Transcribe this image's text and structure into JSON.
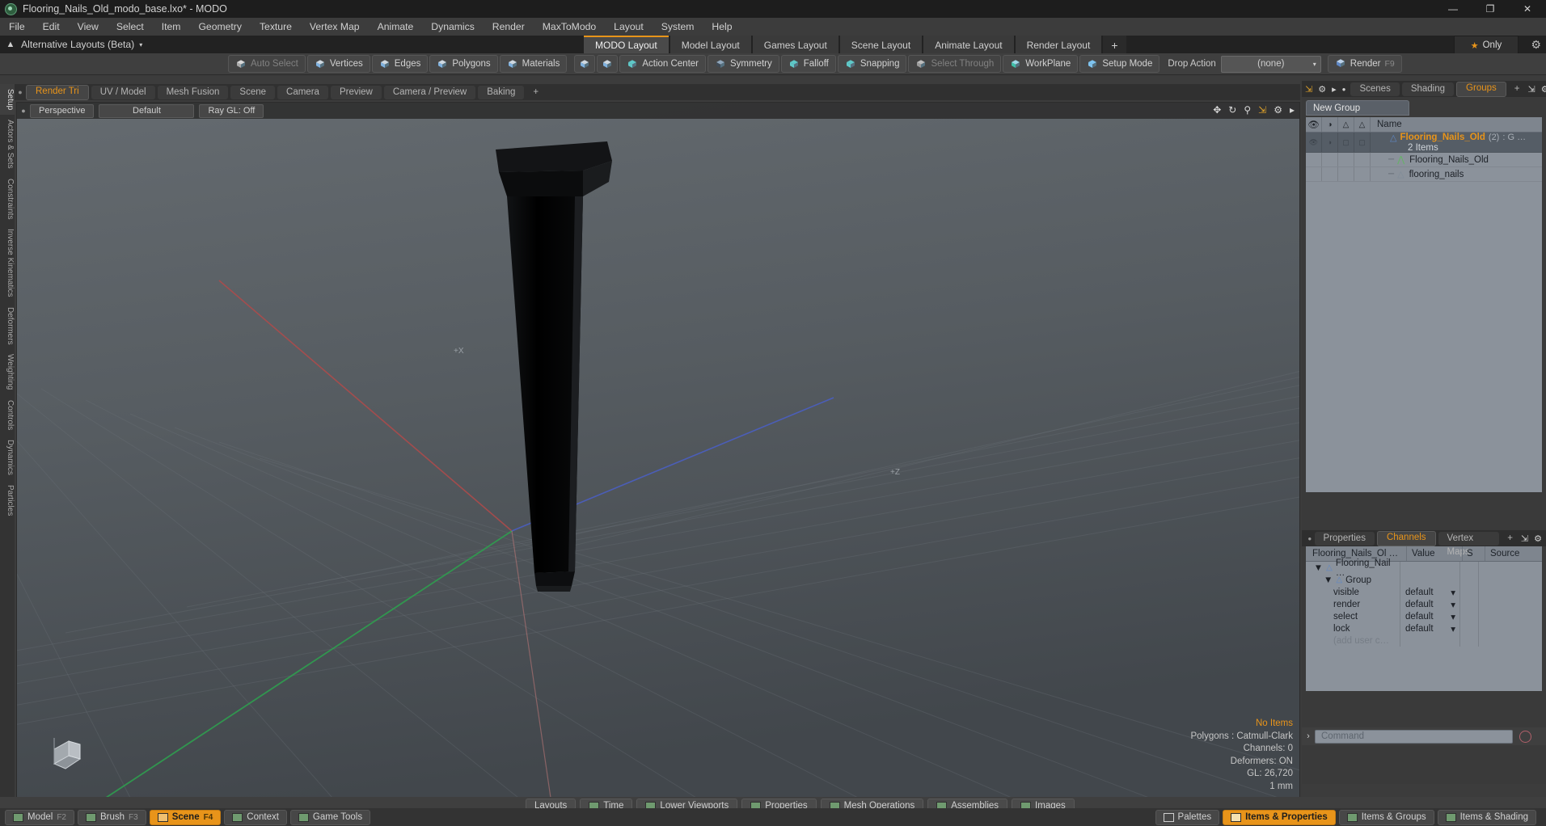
{
  "titlebar": {
    "title": "Flooring_Nails_Old_modo_base.lxo* - MODO",
    "app_icon": "modo-orb-icon",
    "minimize": "—",
    "maximize": "❐",
    "close": "✕"
  },
  "menubar": {
    "items": [
      "File",
      "Edit",
      "View",
      "Select",
      "Item",
      "Geometry",
      "Texture",
      "Vertex Map",
      "Animate",
      "Dynamics",
      "Render",
      "MaxToModo",
      "Layout",
      "System",
      "Help"
    ]
  },
  "altbar": {
    "up_icon": "up-arrow-icon",
    "label": "Alternative Layouts (Beta)",
    "caret": "▾",
    "only_label": "Only",
    "only_star": "★",
    "gear": "⚙"
  },
  "layout_tabs": {
    "items": [
      {
        "label": "MODO Layout",
        "active": true
      },
      {
        "label": "Model Layout",
        "active": false
      },
      {
        "label": "Games Layout",
        "active": false
      },
      {
        "label": "Scene Layout",
        "active": false
      },
      {
        "label": "Animate Layout",
        "active": false
      },
      {
        "label": "Render Layout",
        "active": false
      }
    ],
    "plus": "+"
  },
  "toolbar": {
    "buttons": [
      {
        "label": "Auto Select",
        "icon": "cube-gray-icon",
        "dim": true
      },
      {
        "label": "Vertices",
        "icon": "cube-vertices-icon",
        "dim": false
      },
      {
        "label": "Edges",
        "icon": "cube-edges-icon",
        "dim": false
      },
      {
        "label": "Polygons",
        "icon": "cube-polygons-icon",
        "dim": false
      },
      {
        "label": "Materials",
        "icon": "cube-materials-icon",
        "dim": false
      }
    ],
    "icon_only": [
      {
        "icon": "item-mode-icon"
      },
      {
        "icon": "center-mode-icon"
      }
    ],
    "buttons2": [
      {
        "label": "Action Center",
        "icon": "action-center-icon",
        "dim": false
      },
      {
        "label": "Symmetry",
        "icon": "symmetry-icon",
        "dim": false
      },
      {
        "label": "Falloff",
        "icon": "falloff-icon",
        "dim": false
      },
      {
        "label": "Snapping",
        "icon": "snapping-icon",
        "dim": false
      },
      {
        "label": "Select Through",
        "icon": "select-through-icon",
        "dim": true
      },
      {
        "label": "WorkPlane",
        "icon": "workplane-icon",
        "dim": false
      },
      {
        "label": "Setup Mode",
        "icon": "setup-mode-icon",
        "dim": false
      }
    ],
    "drop_action_label": "Drop Action",
    "drop_action_value": "(none)",
    "drop_action_arrow": "▾",
    "render_label": "Render",
    "render_shortcut": "F9",
    "render_icon": "render-globe-icon"
  },
  "left_tabs": {
    "items": [
      "Setup",
      "Actors & Sets",
      "Constraints",
      "Inverse Kinematics",
      "Deformers",
      "Weighting",
      "Controls",
      "Dynamics",
      "Particles"
    ]
  },
  "viewport_tabs": {
    "dot": "●",
    "items": [
      {
        "label": "Render Tri",
        "active": true
      },
      {
        "label": "UV / Model",
        "active": false
      },
      {
        "label": "Mesh Fusion",
        "active": false
      },
      {
        "label": "Scene",
        "active": false
      },
      {
        "label": "Camera",
        "active": false
      },
      {
        "label": "Preview",
        "active": false
      },
      {
        "label": "Camera / Preview",
        "active": false
      },
      {
        "label": "Baking",
        "active": false
      }
    ],
    "plus": "+"
  },
  "viewport": {
    "dot": "●",
    "pills": [
      "Perspective",
      "Default",
      "Ray GL: Off"
    ],
    "header_icons": [
      "move-icon",
      "rotate-icon",
      "zoom-icon",
      "fit-icon",
      "gear-icon",
      "play-icon"
    ],
    "axis_labels": {
      "x": "+X",
      "z": "+Z"
    },
    "info": {
      "items": "No Items",
      "polygons": "Polygons : Catmull-Clark",
      "channels": "Channels: 0",
      "deformers": "Deformers: ON",
      "gl": "GL: 26,720",
      "unit": "1 mm"
    },
    "accent": "#e8941a"
  },
  "right_panel": {
    "top_icons": [
      "expand-icon",
      "gear-icon",
      "play-icon",
      "dot-icon"
    ],
    "tabs": [
      {
        "label": "Scenes",
        "active": false
      },
      {
        "label": "Shading",
        "active": false
      },
      {
        "label": "Groups",
        "active": true
      }
    ],
    "plus": "+",
    "right_icons": [
      "expand-icon",
      "gear-icon"
    ],
    "new_group_button": "New Group",
    "columns": [
      "eye-icon",
      "render-icon",
      "select-icon",
      "lock-icon",
      "Name"
    ],
    "tree": [
      {
        "name": "Flooring_Nails_Old",
        "count": "(2)",
        "suffix": ": G …",
        "subtitle": "2 Items",
        "selected": true,
        "icon": "group-shield-icon",
        "indent": 0
      },
      {
        "name": "Flooring_Nails_Old",
        "selected": false,
        "icon": "locator-axis-icon",
        "indent": 1
      },
      {
        "name": "flooring_nails",
        "selected": false,
        "icon": "mesh-cube-icon",
        "indent": 1
      }
    ]
  },
  "channels_panel": {
    "tabs": [
      {
        "label": "Properties",
        "active": false
      },
      {
        "label": "Channels",
        "active": true
      },
      {
        "label": "Vertex Maps",
        "active": false
      }
    ],
    "plus": "+",
    "right_icons": [
      "expand-icon",
      "gear-icon"
    ],
    "columns": [
      "Flooring_Nails_Ol …",
      "Value",
      "S",
      "Source"
    ],
    "rows": [
      {
        "name": "Flooring_Nail …",
        "value": "",
        "icon": "group-shield-icon",
        "indent": 0,
        "twirl": "▼",
        "dim": false
      },
      {
        "name": "Group",
        "value": "",
        "icon": "group-shield-icon",
        "indent": 1,
        "twirl": "▼",
        "dim": false
      },
      {
        "name": "visible",
        "value": "default",
        "indent": 2,
        "dim": false
      },
      {
        "name": "render",
        "value": "default",
        "indent": 2,
        "dim": false
      },
      {
        "name": "select",
        "value": "default",
        "indent": 2,
        "dim": false
      },
      {
        "name": "lock",
        "value": "default",
        "indent": 2,
        "dim": false
      },
      {
        "name": "(add user c…",
        "value": "",
        "indent": 2,
        "dim": true
      }
    ],
    "dropdown_arrow": "▾"
  },
  "command_bar": {
    "prompt": "›",
    "placeholder": "Command",
    "record_icon": "record-circle-icon"
  },
  "center_bar": {
    "items": [
      {
        "label": "Layouts",
        "icon": null
      },
      {
        "label": "Time",
        "icon": "swatch-icon"
      },
      {
        "label": "Lower Viewports",
        "icon": "swatch-icon"
      },
      {
        "label": "Properties",
        "icon": "swatch-icon"
      },
      {
        "label": "Mesh Operations",
        "icon": "swatch-icon"
      },
      {
        "label": "Assemblies",
        "icon": "swatch-icon"
      },
      {
        "label": "Images",
        "icon": "swatch-icon"
      }
    ]
  },
  "status_bar": {
    "left": [
      {
        "label": "Model",
        "shortcut": "F2",
        "active": false,
        "icon": "swatch-icon"
      },
      {
        "label": "Brush",
        "shortcut": "F3",
        "active": false,
        "icon": "swatch-icon"
      },
      {
        "label": "Scene",
        "shortcut": "F4",
        "active": true,
        "icon": "swatch-icon"
      },
      {
        "label": "Context",
        "shortcut": "",
        "active": false,
        "icon": "swatch-icon"
      },
      {
        "label": "Game Tools",
        "shortcut": "",
        "active": false,
        "icon": "swatch-icon"
      }
    ],
    "right": [
      {
        "label": "Palettes",
        "active": false,
        "icon": "palettes-icon"
      },
      {
        "label": "Items & Properties",
        "active": true,
        "icon": "swatch-icon"
      },
      {
        "label": "Items & Groups",
        "active": false,
        "icon": "swatch-icon"
      },
      {
        "label": "Items & Shading",
        "active": false,
        "icon": "swatch-icon"
      }
    ]
  }
}
